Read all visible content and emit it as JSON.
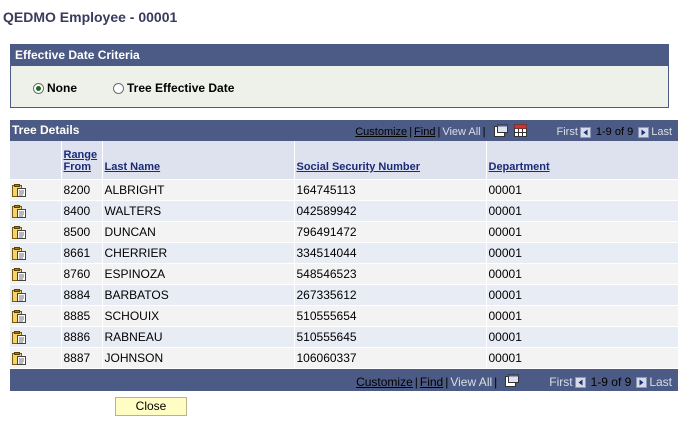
{
  "page": {
    "title": "QEDMO Employee - 00001"
  },
  "criteria": {
    "header": "Effective Date Criteria",
    "options": [
      {
        "label": "None",
        "selected": true
      },
      {
        "label": "Tree Effective Date",
        "selected": false
      }
    ]
  },
  "grid": {
    "title": "Tree Details",
    "nav": {
      "customize": "Customize",
      "find": "Find",
      "view_all": "View All",
      "first": "First",
      "range": "1-9 of 9",
      "last": "Last"
    },
    "columns": {
      "range_from": "Range From",
      "last_name": "Last Name",
      "ssn": "Social Security Number",
      "department": "Department"
    },
    "rows": [
      {
        "range_from": "8200",
        "last_name": "ALBRIGHT",
        "ssn": "164745113",
        "department": "00001"
      },
      {
        "range_from": "8400",
        "last_name": "WALTERS",
        "ssn": "042589942",
        "department": "00001"
      },
      {
        "range_from": "8500",
        "last_name": "DUNCAN",
        "ssn": "796491472",
        "department": "00001"
      },
      {
        "range_from": "8661",
        "last_name": "CHERRIER",
        "ssn": "334514044",
        "department": "00001"
      },
      {
        "range_from": "8760",
        "last_name": "ESPINOZA",
        "ssn": "548546523",
        "department": "00001"
      },
      {
        "range_from": "8884",
        "last_name": "BARBATOS",
        "ssn": "267335612",
        "department": "00001"
      },
      {
        "range_from": "8885",
        "last_name": "SCHOUIX",
        "ssn": "510555654",
        "department": "00001"
      },
      {
        "range_from": "8886",
        "last_name": "RABNEAU",
        "ssn": "510555645",
        "department": "00001"
      },
      {
        "range_from": "8887",
        "last_name": "JOHNSON",
        "ssn": "106060337",
        "department": "00001"
      }
    ],
    "row_icon": "row-detail-icon"
  },
  "buttons": {
    "close": "Close"
  },
  "colors": {
    "header_bar": "#4c5b85",
    "column_header": "#dde2ee",
    "row_odd": "#f3f3f3",
    "row_even": "#e8ecf4",
    "button": "#fffcc4"
  }
}
